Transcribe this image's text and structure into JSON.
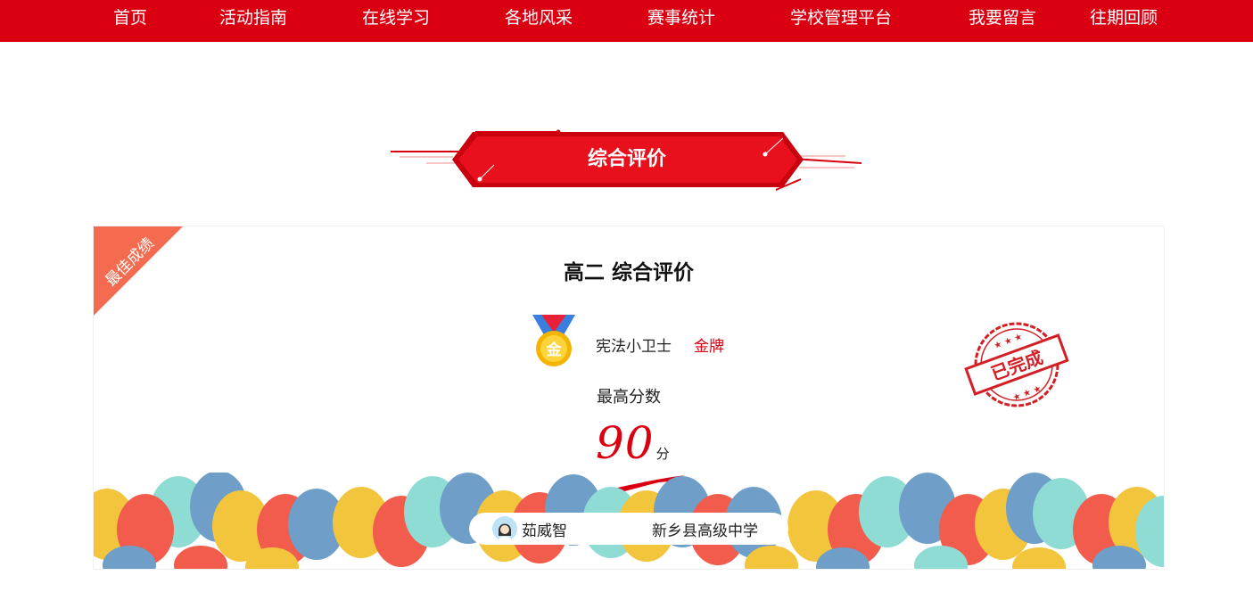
{
  "nav": {
    "items": [
      {
        "label": "首页"
      },
      {
        "label": "活动指南"
      },
      {
        "label": "在线学习"
      },
      {
        "label": "各地风采"
      },
      {
        "label": "赛事统计"
      },
      {
        "label": "学校管理平台"
      },
      {
        "label": "我要留言"
      },
      {
        "label": "往期回顾"
      }
    ]
  },
  "section": {
    "title": "综合评价"
  },
  "card": {
    "ribbon": "最佳成绩",
    "title": "高二 综合评价",
    "medal_icon": "gold-medal-icon",
    "medal_icon_text": "金",
    "medal_name": "宪法小卫士",
    "medal_level": "金牌",
    "score_label": "最高分数",
    "score_value": "90",
    "score_unit": "分",
    "stamp_text": "已完成",
    "user": {
      "name": "茹威智",
      "school": "新乡县高级中学",
      "avatar_icon": "student-avatar-icon"
    }
  },
  "colors": {
    "brand_red": "#da0011",
    "ribbon": "#f56b50",
    "balloon_yellow": "#f3c53c",
    "balloon_red": "#f25c4c",
    "balloon_teal": "#8fdcd4",
    "balloon_blue": "#6f9ec9"
  }
}
